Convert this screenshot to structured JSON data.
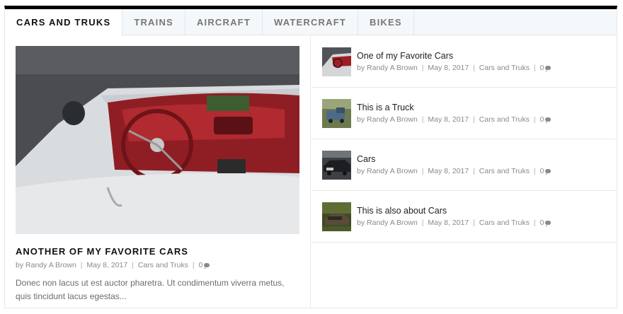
{
  "tabs": [
    "Cars and Truks",
    "Trains",
    "Aircraft",
    "Watercraft",
    "Bikes"
  ],
  "active_tab": 0,
  "featured": {
    "title": "Another of my Favorite Cars",
    "by": "by",
    "author": "Randy A Brown",
    "date": "May 8, 2017",
    "category": "Cars and Truks",
    "comments": "0",
    "excerpt": "Donec non lacus ut est auctor pharetra. Ut condimentum viverra metus, quis tincidunt lacus egestas..."
  },
  "posts": [
    {
      "title": "One of my Favorite Cars",
      "by": "by",
      "author": "Randy A Brown",
      "date": "May 8, 2017",
      "category": "Cars and Truks",
      "comments": "0",
      "thumb": "red-car-thumbnail"
    },
    {
      "title": "This is a Truck",
      "by": "by",
      "author": "Randy A Brown",
      "date": "May 8, 2017",
      "category": "Cars and Truks",
      "comments": "0",
      "thumb": "truck-thumbnail"
    },
    {
      "title": "Cars",
      "by": "by",
      "author": "Randy A Brown",
      "date": "May 8, 2017",
      "category": "Cars and Truks",
      "comments": "0",
      "thumb": "car-thumbnail"
    },
    {
      "title": "This is also about Cars",
      "by": "by",
      "author": "Randy A Brown",
      "date": "May 8, 2017",
      "category": "Cars and Truks",
      "comments": "0",
      "thumb": "abandoned-car-thumbnail"
    }
  ],
  "separator": "|",
  "icons": {
    "comment": "comment-icon"
  },
  "colors": {
    "top_bar": "#000000",
    "tab_bar": "#f4f8fb",
    "title": "#111111",
    "meta": "#8a8a8a"
  }
}
